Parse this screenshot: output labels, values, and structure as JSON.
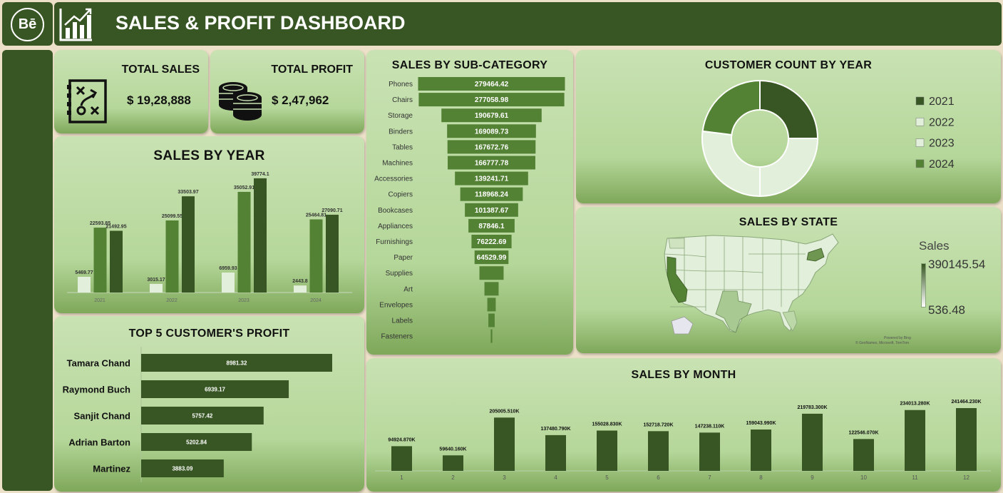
{
  "header": {
    "logo_text": "Bē",
    "title": "SALES & PROFIT DASHBOARD"
  },
  "kpis": {
    "total_sales_label": "TOTAL SALES",
    "total_sales_value": "$ 19,28,888",
    "total_profit_label": "TOTAL PROFIT",
    "total_profit_value": "$ 2,47,962"
  },
  "titles": {
    "sales_by_year": "SALES BY YEAR",
    "top5": "TOP 5 CUSTOMER'S PROFIT",
    "subcategory": "SALES BY SUB-CATEGORY",
    "customer_count": "CUSTOMER COUNT BY YEAR",
    "sales_by_state": "SALES BY STATE",
    "sales_by_month": "SALES BY MONTH"
  },
  "map": {
    "legend_title": "Sales",
    "legend_max": "390145.54",
    "legend_min": "536.48",
    "credit_1": "Powered by Bing",
    "credit_2": "© GeoNames, Microsoft, TomTom"
  },
  "colors": {
    "dark": "#375623",
    "mid": "#548235",
    "light": "#e2efda",
    "accent": "#a9d08e"
  },
  "chart_data": [
    {
      "id": "sales_by_year",
      "type": "bar",
      "title": "SALES BY YEAR",
      "categories": [
        "2021",
        "2022",
        "2023",
        "2024"
      ],
      "series": [
        {
          "values": [
            5469.77,
            3015.17,
            6959.93,
            2443.8
          ],
          "color": "#e2efda"
        },
        {
          "values": [
            22593.85,
            25099.55,
            35052.91,
            25464.81
          ],
          "color": "#548235"
        },
        {
          "values": [
            21492.95,
            33503.97,
            39774.1,
            27090.71
          ],
          "color": "#375623"
        }
      ],
      "labels": [
        [
          "5469.77",
          "22593.85",
          "21492.95"
        ],
        [
          "3015.17",
          "25099.55",
          "33503.97"
        ],
        [
          "6959.93",
          "35052.91",
          "39774.1"
        ],
        [
          "2443.8",
          "25464.81",
          "27090.71"
        ]
      ],
      "ylim": [
        0,
        40000
      ]
    },
    {
      "id": "top5_customers_profit",
      "type": "bar",
      "orientation": "horizontal",
      "title": "TOP 5 CUSTOMER'S PROFIT",
      "categories": [
        "Tamara Chand",
        "Raymond Buch",
        "Sanjit Chand",
        "Adrian Barton",
        "Martinez"
      ],
      "values": [
        8981.32,
        6939.17,
        5757.42,
        5202.84,
        3883.09
      ],
      "labels": [
        "8981.32",
        "6939.17",
        "5757.42",
        "5202.84",
        "3883.09"
      ]
    },
    {
      "id": "sales_by_subcategory",
      "type": "bar",
      "orientation": "funnel",
      "title": "SALES BY SUB-CATEGORY",
      "categories": [
        "Phones",
        "Chairs",
        "Storage",
        "Binders",
        "Tables",
        "Machines",
        "Accessories",
        "Copiers",
        "Bookcases",
        "Appliances",
        "Furnishings",
        "Paper",
        "Supplies",
        "Art",
        "Envelopes",
        "Labels",
        "Fasteners"
      ],
      "values": [
        279464.42,
        277058.98,
        190679.61,
        169089.73,
        167672.76,
        166777.78,
        139241.71,
        118968.24,
        101387.67,
        87846.1,
        76222.69,
        64529.99,
        46000,
        27000,
        16000,
        12000,
        3000
      ],
      "labels": [
        "279464.42",
        "277058.98",
        "190679.61",
        "169089.73",
        "167672.76",
        "166777.78",
        "139241.71",
        "118968.24",
        "101387.67",
        "87846.1",
        "76222.69",
        "64529.99",
        "",
        "",
        "",
        "",
        ""
      ]
    },
    {
      "id": "customer_count_by_year",
      "type": "pie",
      "title": "CUSTOMER COUNT BY YEAR",
      "categories": [
        "2021",
        "2022",
        "2023",
        "2024"
      ],
      "values": [
        25,
        25,
        27,
        23
      ],
      "colors": [
        "#375623",
        "#e2efda",
        "#e2efda",
        "#548235"
      ],
      "legend": "right"
    },
    {
      "id": "sales_by_month",
      "type": "bar",
      "title": "SALES BY MONTH",
      "categories": [
        "1",
        "2",
        "3",
        "4",
        "5",
        "6",
        "7",
        "8",
        "9",
        "10",
        "11",
        "12"
      ],
      "values": [
        94924.87,
        59640.16,
        205005.51,
        137480.79,
        155028.83,
        152718.72,
        147238.11,
        159043.99,
        219783.3,
        122546.07,
        234013.28,
        241464.23
      ],
      "labels": [
        "94924.870K",
        "59640.160K",
        "205005.510K",
        "137480.790K",
        "155028.830K",
        "152718.720K",
        "147238.110K",
        "159043.990K",
        "219783.300K",
        "122546.070K",
        "234013.280K",
        "241464.230K"
      ]
    }
  ]
}
